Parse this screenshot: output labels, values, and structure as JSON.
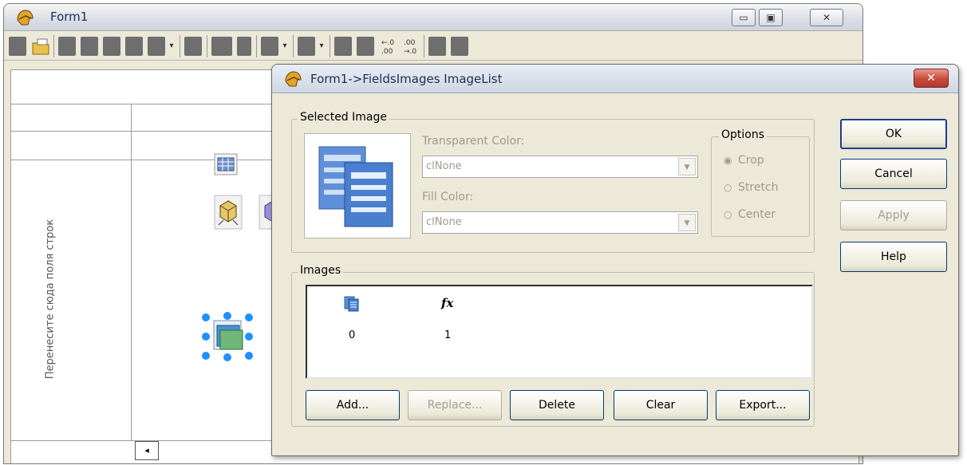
{
  "form1": {
    "title": "Form1",
    "caption_buttons": {
      "minimize": "▭",
      "maximize": "▣",
      "close": "✕"
    },
    "vertical_hint": "Перенесите сюда поля строк",
    "scroll_left_glyph": "◂"
  },
  "dialog": {
    "title": "Form1->FieldsImages ImageList",
    "close_glyph": "✕",
    "selected_image": {
      "legend": "Selected Image",
      "transparent_color_label": "Transparent Color:",
      "transparent_color_value": "clNone",
      "fill_color_label": "Fill Color:",
      "fill_color_value": "clNone",
      "combo_arrow": "▼"
    },
    "options": {
      "legend": "Options",
      "items": [
        {
          "label": "Crop",
          "checked": true
        },
        {
          "label": "Stretch",
          "checked": false
        },
        {
          "label": "Center",
          "checked": false
        }
      ],
      "checked_glyph": "◉",
      "unchecked_glyph": "○"
    },
    "buttons": {
      "ok": "OK",
      "cancel": "Cancel",
      "apply": "Apply",
      "help": "Help"
    },
    "images": {
      "legend": "Images",
      "items": [
        {
          "index": "0",
          "icon": "table-grid-icon"
        },
        {
          "index": "1",
          "icon": "fx-icon",
          "glyph": "fx"
        }
      ],
      "buttons": {
        "add": "Add...",
        "replace": "Replace...",
        "delete": "Delete",
        "clear": "Clear",
        "export": "Export..."
      }
    }
  },
  "colors": {
    "dialog_bg": "#ece9d8",
    "title_text": "#1b2f55",
    "close_red": "#c8493a",
    "disabled_text": "#9e9a8e",
    "selection_blue": "#1e90ff"
  }
}
